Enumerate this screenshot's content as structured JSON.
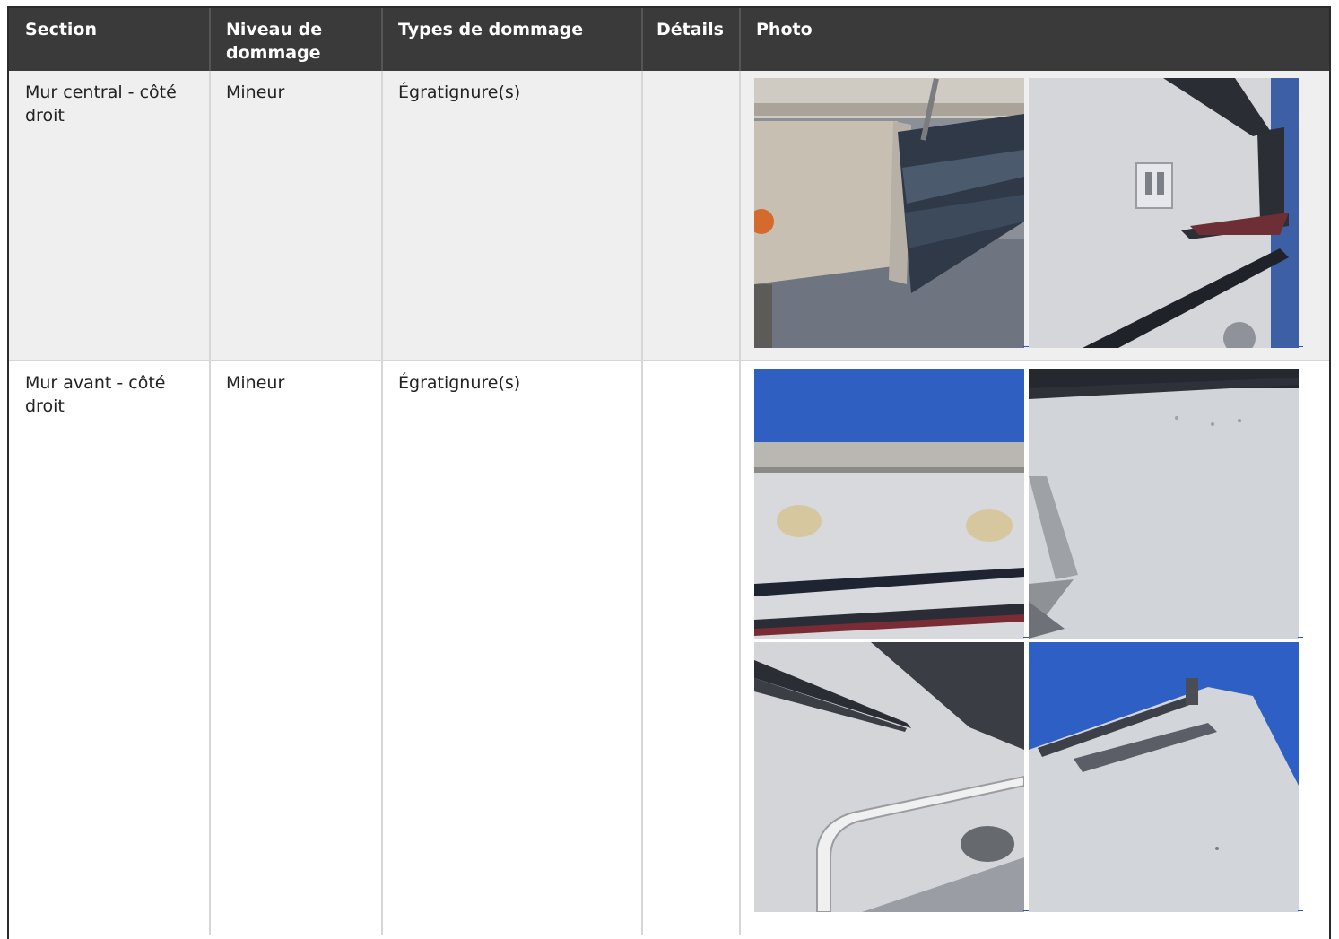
{
  "table": {
    "headers": {
      "section": "Section",
      "niveau": "Niveau de dommage",
      "types": "Types de dommage",
      "details": "Détails",
      "photo": "Photo"
    },
    "rows": [
      {
        "section": "Mur central - côté droit",
        "niveau": "Mineur",
        "types": "Égratignure(s)",
        "details": "",
        "photos": [
          "photo-storage-compartment",
          "photo-sidewall-latch"
        ]
      },
      {
        "section": "Mur avant - côté droit",
        "niveau": "Mineur",
        "types": "Égratignure(s)",
        "details": "",
        "photos": [
          "photo-trim-caps",
          "photo-sidewall-scratch",
          "photo-window-frame",
          "photo-roof-rail"
        ]
      }
    ]
  },
  "colors": {
    "header_bg": "#3a3a3a",
    "header_text": "#ffffff",
    "row_alt_bg": "#efefef",
    "border": "#d6d6d6",
    "link": "#2a55c8"
  }
}
